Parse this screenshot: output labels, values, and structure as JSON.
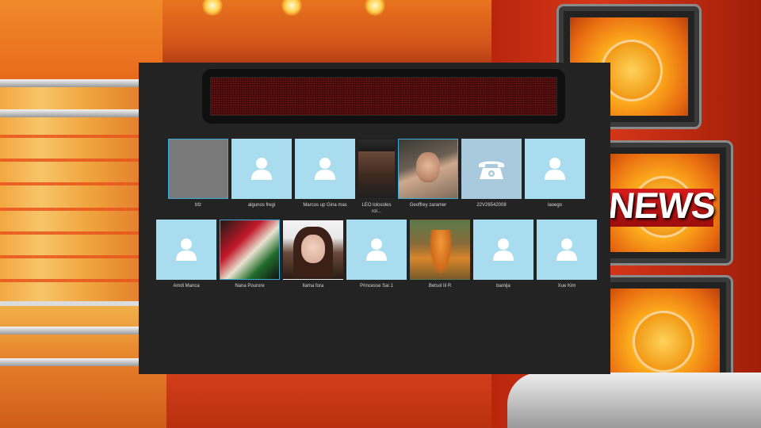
{
  "ticker": {
    "text": ""
  },
  "contacts_row1": [
    {
      "name": "bfz",
      "avatar": "gray",
      "selected": true
    },
    {
      "name": "algunos fregi",
      "avatar": "person-icon"
    },
    {
      "name": "Marcos up Gina mas",
      "avatar": "person-icon"
    },
    {
      "name": "LEO lolosoles rol...",
      "avatar": "photo"
    },
    {
      "name": "Geoffrey zaramer",
      "avatar": "photo",
      "selected": true
    },
    {
      "name": "22V26542008",
      "avatar": "phone-icon"
    },
    {
      "name": "laoego",
      "avatar": "person-icon"
    }
  ],
  "contacts_row2": [
    {
      "name": "Amdi Manca",
      "avatar": "person-icon"
    },
    {
      "name": "Nana Pourore",
      "avatar": "photo",
      "selected": true
    },
    {
      "name": "llama fora",
      "avatar": "photo"
    },
    {
      "name": "Princesse Sai 1",
      "avatar": "person-icon"
    },
    {
      "name": "Betsol lil R",
      "avatar": "photo"
    },
    {
      "name": "bamija",
      "avatar": "person-icon"
    },
    {
      "name": "Xue Kim",
      "avatar": "person-icon"
    }
  ],
  "colors": {
    "panel": "#232323",
    "tile_default": "#a9dcef",
    "selected_border": "#3fa9d8",
    "ticker_led": "#6e1414"
  }
}
